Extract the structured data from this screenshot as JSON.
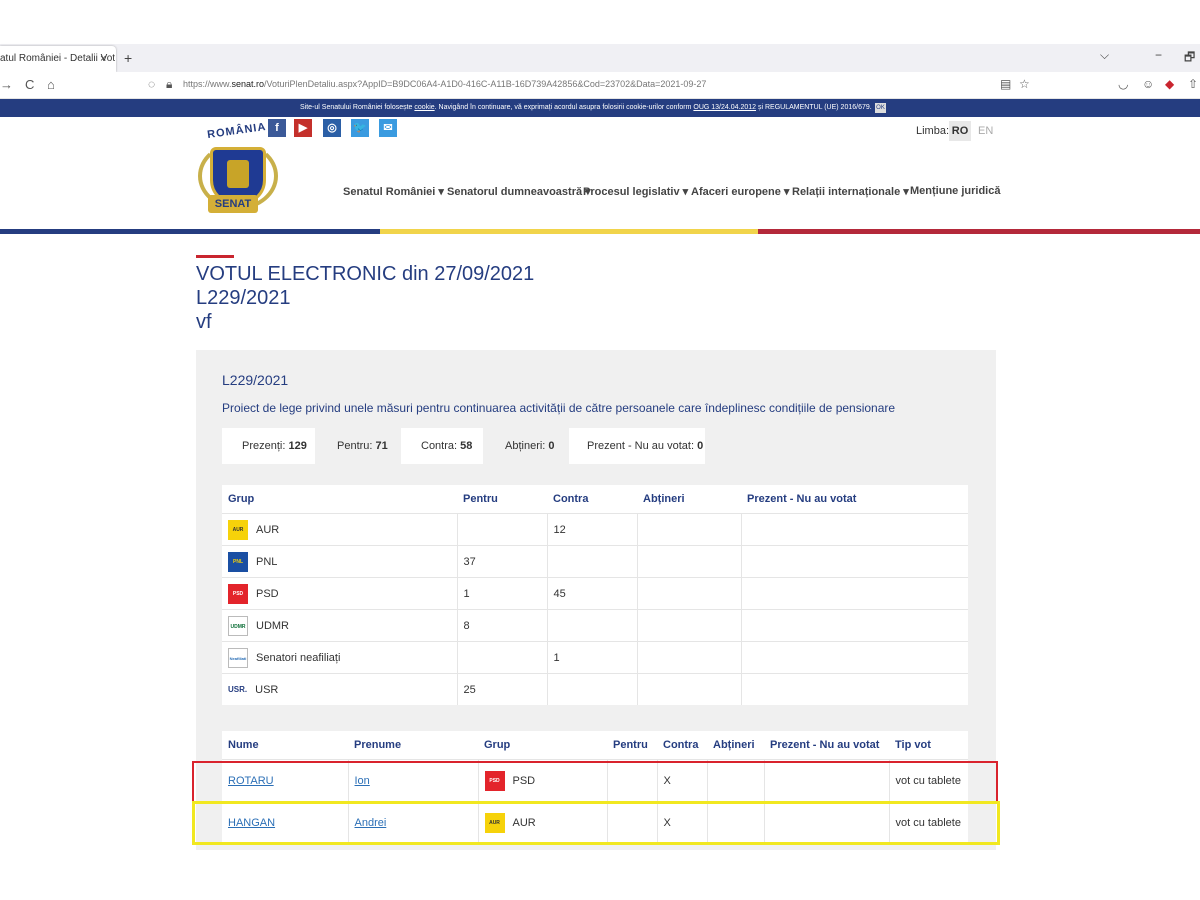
{
  "browser": {
    "tab_title": "atul României - Detalii Vot",
    "tab_close": "×",
    "new_tab": "+",
    "url_prefix": "https://www.",
    "url_domain": "senat.ro",
    "url_rest": "/VoturiPlenDetaliu.aspx?AppID=B9DC06A4-A1D0-416C-A11B-16D739A42856&Cod=23702&Data=2021-09-27",
    "back": "→",
    "reload": "C",
    "home": "⌂",
    "window_menu": "⌵",
    "minimize": "−",
    "restore": "🗗"
  },
  "cookie_bar": {
    "text_1": "Site-ul Senatului României folosește ",
    "link_cookie": "cookie",
    "text_2": ". Navigând în continuare, vă exprimați acordul asupra folosirii cookie-urilor conform ",
    "link_oug": "OUG 13/24.04.2012",
    "text_3": " și REGULAMENTUL (UE) 2016/679.",
    "ok": "OK"
  },
  "header": {
    "logo_top": "ROMÂNIA",
    "logo_bottom": "SENAT",
    "social": [
      {
        "icon": "facebook-icon",
        "glyph": "f",
        "color": "#3b5998"
      },
      {
        "icon": "youtube-icon",
        "glyph": "▶",
        "color": "#c4302b"
      },
      {
        "icon": "instagram-icon",
        "glyph": "◎",
        "color": "#2b5fa6"
      },
      {
        "icon": "twitter-icon",
        "glyph": "🐦",
        "color": "#3a9be0"
      },
      {
        "icon": "mail-icon",
        "glyph": "✉",
        "color": "#3a9be0"
      }
    ],
    "lang_label": "Limba:",
    "lang_ro": "RO",
    "lang_en": "EN",
    "nav": [
      "Senatul României ▾",
      "Senatorul dumneavoastră ▾",
      "Procesul legislativ ▾",
      "Afaceri europene ▾",
      "Relații internaționale ▾",
      "Mențiune juridică"
    ],
    "colors": {
      "blue": "#253d80",
      "yellow": "#f1d44b",
      "red": "#b4293a"
    }
  },
  "page": {
    "title_line1": "VOTUL ELECTRONIC din 27/09/2021",
    "title_line2": "L229/2021",
    "title_line3": "vf"
  },
  "vote": {
    "code": "L229/2021",
    "description": "Proiect de lege privind unele măsuri pentru continuarea activității de către persoanele care îndeplinesc condițiile de pensionare",
    "stats": [
      {
        "label": "Prezenți: ",
        "value": "129"
      },
      {
        "label": "Pentru: ",
        "value": "71"
      },
      {
        "label": "Contra: ",
        "value": "58"
      },
      {
        "label": "Abțineri: ",
        "value": "0"
      },
      {
        "label": "Prezent - Nu au votat: ",
        "value": "0"
      }
    ]
  },
  "group_table": {
    "headers": [
      "Grup",
      "Pentru",
      "Contra",
      "Abțineri",
      "Prezent - Nu au votat"
    ],
    "rows": [
      {
        "logo": "AUR",
        "name": "AUR",
        "pentru": "",
        "contra": "12",
        "abtineri": "",
        "prezent": ""
      },
      {
        "logo": "PNL",
        "name": "PNL",
        "pentru": "37",
        "contra": "",
        "abtineri": "",
        "prezent": ""
      },
      {
        "logo": "PSD",
        "name": "PSD",
        "pentru": "1",
        "contra": "45",
        "abtineri": "",
        "prezent": ""
      },
      {
        "logo": "UDMR",
        "name": "UDMR",
        "pentru": "8",
        "contra": "",
        "abtineri": "",
        "prezent": ""
      },
      {
        "logo": "Neafiliati",
        "name": "Senatori neafiliați",
        "pentru": "",
        "contra": "1",
        "abtineri": "",
        "prezent": ""
      },
      {
        "logo": "USR.",
        "name": "USR",
        "pentru": "25",
        "contra": "",
        "abtineri": "",
        "prezent": ""
      }
    ]
  },
  "vote_table": {
    "headers": [
      "Nume",
      "Prenume",
      "Grup",
      "Pentru",
      "Contra",
      "Abțineri",
      "Prezent - Nu au votat",
      "Tip vot"
    ],
    "rows": [
      {
        "nume": "ROTARU",
        "prenume": "Ion",
        "grup_logo": "PSD",
        "grup": "PSD",
        "pentru": "",
        "contra": "X",
        "abtineri": "",
        "prezent": "",
        "tip": "vot cu tablete"
      },
      {
        "nume": "HANGAN",
        "prenume": "Andrei",
        "grup_logo": "AUR",
        "grup": "AUR",
        "pentru": "",
        "contra": "X",
        "abtineri": "",
        "prezent": "",
        "tip": "vot cu tablete"
      }
    ]
  }
}
